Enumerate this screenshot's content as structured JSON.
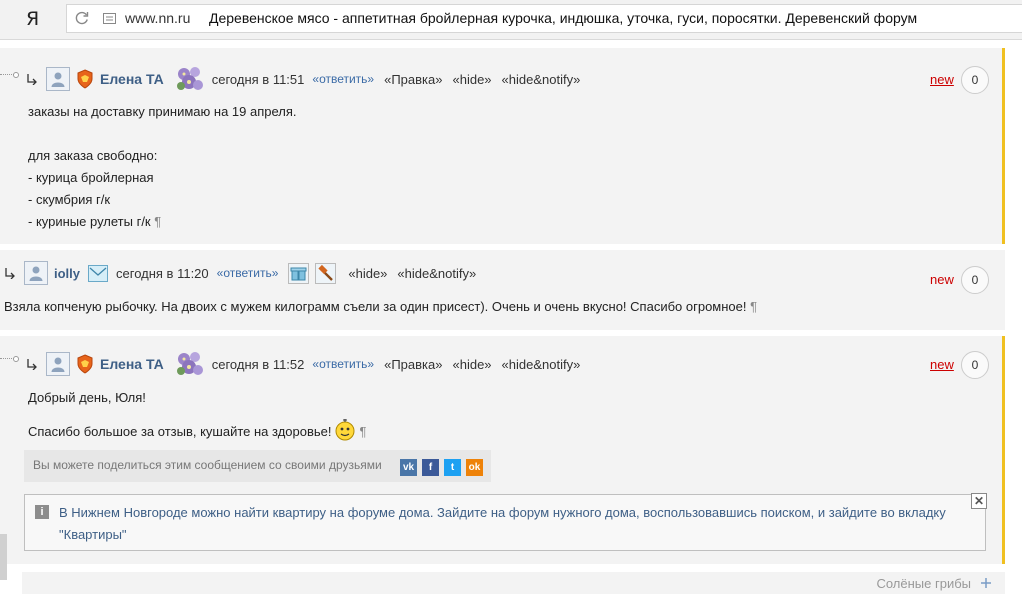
{
  "browser": {
    "logo": "Я",
    "domain": "www.nn.ru",
    "title": "Деревенское мясо - аппетитная бройлерная курочка, индюшка, уточка, гуси, поросятки. Деревенский форум"
  },
  "common": {
    "reply": "«ответить»",
    "hide": "«hide»",
    "hide_notify": "«hide&notify»",
    "edit": "«Правка»",
    "new": "new",
    "pilcrow": "¶"
  },
  "comments": [
    {
      "author": "Елена ТА",
      "time": "сегодня в 11:51",
      "votes": "0",
      "lines": [
        "заказы на доставку принимаю на 19 апреля.",
        "для заказа свободно:",
        "- курица бройлерная",
        "- скумбрия г/к",
        "- куриные рулеты г/к"
      ]
    },
    {
      "author": "iolly",
      "time": "сегодня в 11:20",
      "votes": "0",
      "lines": [
        "Взяла копченую рыбочку. На двоих с мужем килограмм съели за один присест). Очень и очень вкусно! Спасибо огромное!"
      ]
    },
    {
      "author": "Елена ТА",
      "time": "сегодня в 11:52",
      "votes": "0",
      "lines": [
        "Добрый день, Юля!",
        "Спасибо большое за отзыв, кушайте на здоровье!"
      ]
    }
  ],
  "share": {
    "text": "Вы можете поделиться этим сообщением со своими друзьями",
    "networks": [
      "vk",
      "fb",
      "tw",
      "ok"
    ]
  },
  "promo": {
    "line1": "В Нижнем Новгороде можно найти квартиру на форуме дома. Зайдите на форум нужного дома, воспользовавшись поиском, и зайдите во вкладку",
    "line2": "\"Квартиры\""
  },
  "next_section": "Солёные грибы",
  "colors": {
    "author": "#3e5f86",
    "new_link": "#cc0000",
    "accent": "#f0c020",
    "vk": "#4a76a8",
    "fb": "#3b5998",
    "tw": "#1da1f2",
    "ok": "#ee8208"
  }
}
